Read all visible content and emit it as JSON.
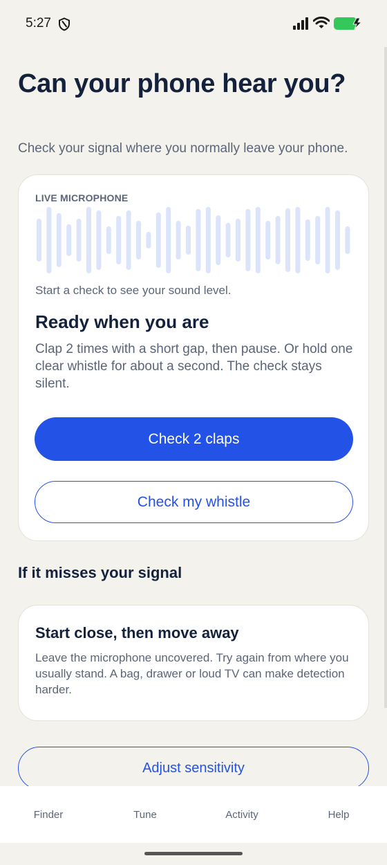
{
  "status_bar": {
    "time": "5:27",
    "icons": [
      "shield-icon",
      "cellular-signal-icon",
      "wifi-icon",
      "battery-charging-icon"
    ],
    "battery_color": "#34c759"
  },
  "header": {
    "title": "Can your phone hear you?",
    "subtitle": "Check your signal where you normally leave your phone."
  },
  "mic_card": {
    "label": "LIVE MICROPHONE",
    "hint": "Start a check to see your sound level.",
    "ready_title": "Ready when you are",
    "ready_body": "Clap 2 times with a short gap, then pause. Or hold one clear whistle for about a second. The check stays silent.",
    "primary_button": "Check 2 claps",
    "secondary_button": "Check my whistle",
    "waveform_color": "#dce4fb"
  },
  "signal_section": {
    "heading": "If it misses your signal",
    "tip_title": "Start close, then move away",
    "tip_body": "Leave the microphone uncovered. Try again from where you usually stand. A bag, drawer or loud TV can make detection harder.",
    "adjust_button": "Adjust sensitivity"
  },
  "bottom_nav": {
    "items": [
      {
        "label": "Finder"
      },
      {
        "label": "Tune"
      },
      {
        "label": "Activity"
      },
      {
        "label": "Help"
      }
    ]
  },
  "colors": {
    "accent": "#2352e6",
    "background": "#f3f2ed",
    "text_primary": "#14213d",
    "text_secondary": "#5b6577"
  }
}
